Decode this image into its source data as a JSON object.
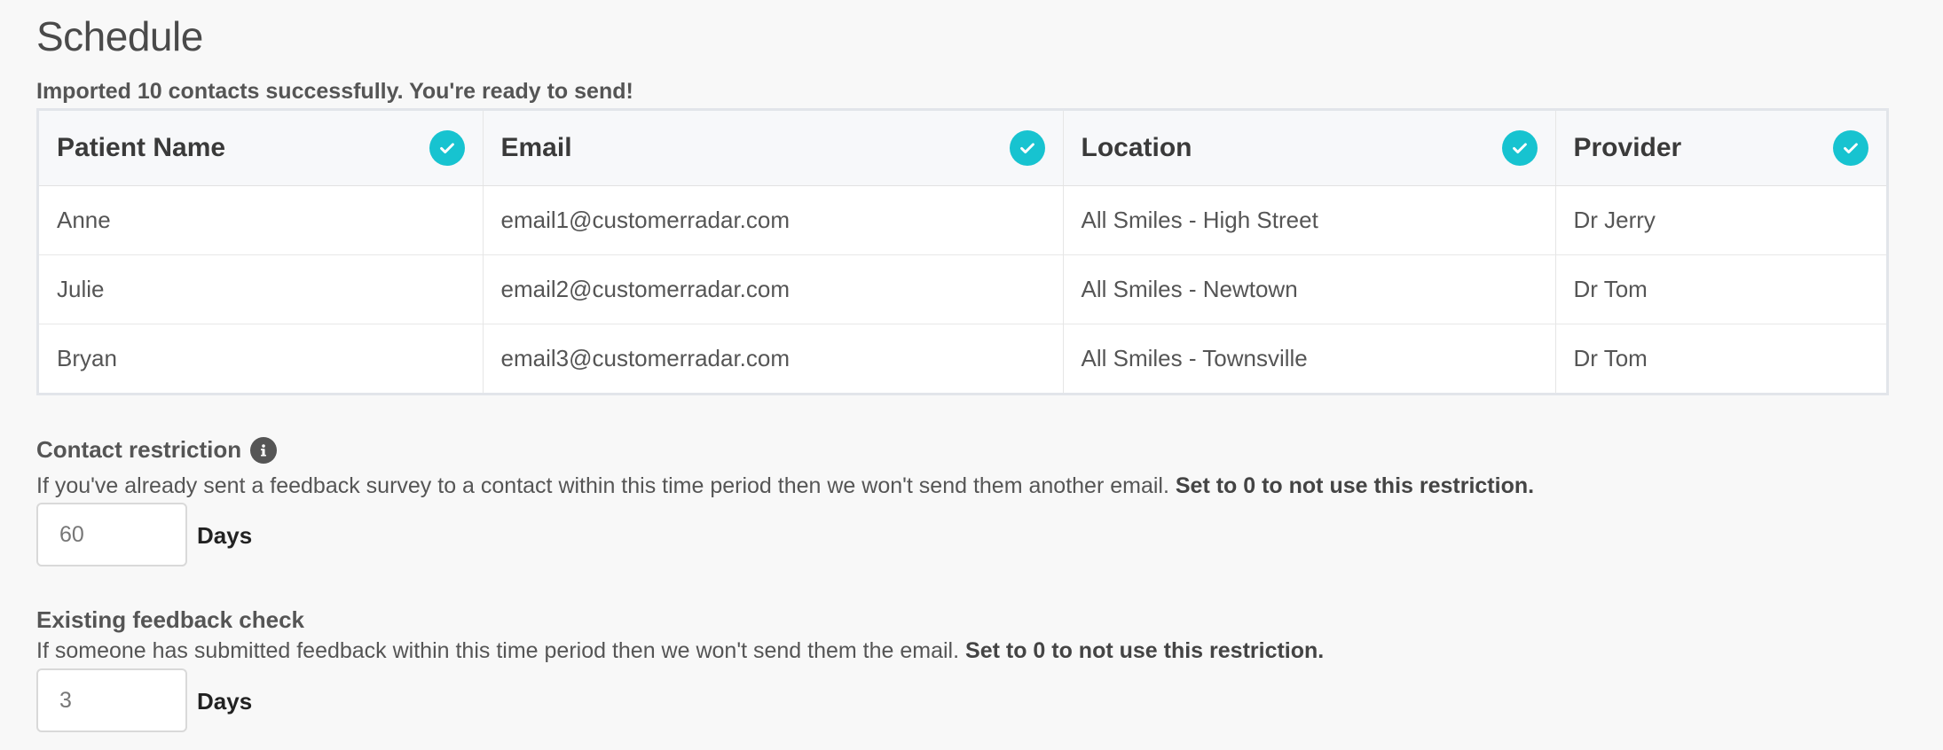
{
  "page": {
    "title": "Schedule"
  },
  "import_status": "Imported 10 contacts successfully. You're ready to send!",
  "table": {
    "columns": [
      {
        "label": "Patient Name",
        "status": "check-icon"
      },
      {
        "label": "Email",
        "status": "check-icon"
      },
      {
        "label": "Location",
        "status": "check-icon"
      },
      {
        "label": "Provider",
        "status": "check-icon"
      }
    ],
    "rows": [
      [
        "Anne",
        "email1@customerradar.com",
        "All Smiles - High Street",
        "Dr Jerry"
      ],
      [
        "Julie",
        "email2@customerradar.com",
        "All Smiles - Newtown",
        "Dr Tom"
      ],
      [
        "Bryan",
        "email3@customerradar.com",
        "All Smiles - Townsville",
        "Dr Tom"
      ]
    ]
  },
  "contact_restriction": {
    "label": "Contact restriction",
    "help": "If you've already sent a feedback survey to a contact within this time period then we won't send them another email.",
    "help_bold": "Set to 0 to not use this restriction.",
    "value": "60",
    "unit": "Days"
  },
  "feedback_check": {
    "label": "Existing feedback check",
    "help": "If someone has submitted feedback within this time period then we won't send them the email.",
    "help_bold": "Set to 0 to not use this restriction.",
    "value": "3",
    "unit": "Days"
  },
  "colors": {
    "accent": "#17c3d0",
    "background": "#f8f8f8"
  }
}
